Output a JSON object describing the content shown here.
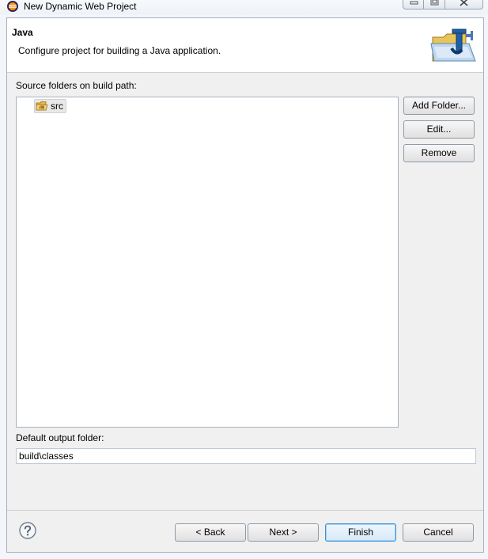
{
  "window": {
    "title": "New Dynamic Web Project"
  },
  "header": {
    "title": "Java",
    "description": "Configure project for building a Java application.",
    "icon": "java-folder-icon"
  },
  "source_folders": {
    "label": "Source folders on build path:",
    "items": [
      {
        "label": "src",
        "icon": "source-package-folder-icon"
      }
    ]
  },
  "side_buttons": {
    "add_folder": "Add Folder...",
    "edit": "Edit...",
    "remove": "Remove"
  },
  "output": {
    "label": "Default output folder:",
    "value": "build\\classes"
  },
  "footer": {
    "help_icon": "help-icon",
    "back": "< Back",
    "next": "Next >",
    "finish": "Finish",
    "cancel": "Cancel"
  },
  "colors": {
    "accent": "#3c90d6",
    "frame_background": "#f0f0f0",
    "header_background": "#ffffff"
  }
}
